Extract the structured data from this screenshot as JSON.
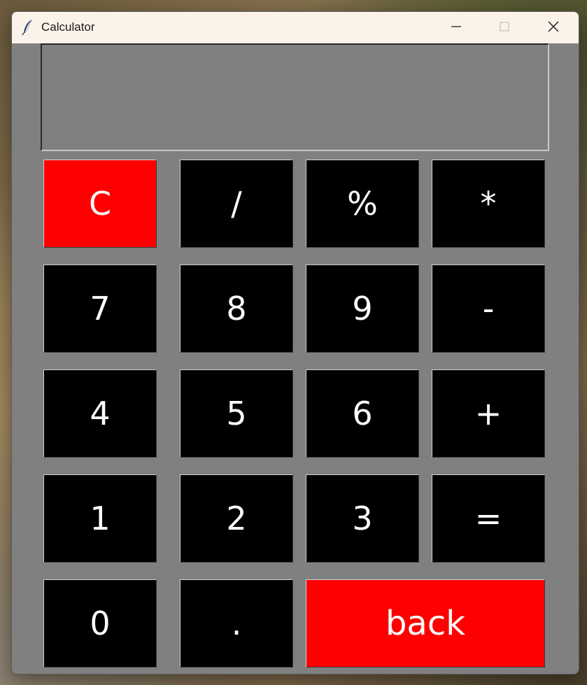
{
  "window": {
    "title": "Calculator",
    "controls": {
      "minimize": "minimize",
      "maximize": "maximize",
      "close": "close"
    }
  },
  "display": {
    "value": ""
  },
  "keys": {
    "clear": "C",
    "divide": "/",
    "percent": "%",
    "multiply": "*",
    "seven": "7",
    "eight": "8",
    "nine": "9",
    "subtract": "-",
    "four": "4",
    "five": "5",
    "six": "6",
    "add": "+",
    "one": "1",
    "two": "2",
    "three": "3",
    "equals": "=",
    "zero": "0",
    "decimal": ".",
    "back": "back"
  },
  "colors": {
    "body": "#808080",
    "key": "#000000",
    "key_accent": "#ff0000",
    "key_text": "#ffffff",
    "titlebar": "#fbf3e9"
  },
  "icons": {
    "app": "feather-icon",
    "minimize": "minimize-icon",
    "maximize": "maximize-icon",
    "close": "close-icon"
  }
}
